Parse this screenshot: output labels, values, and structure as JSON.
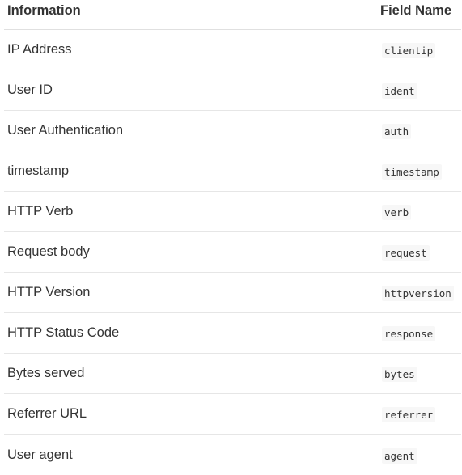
{
  "table": {
    "headers": {
      "information": "Information",
      "field_name": "Field Name"
    },
    "rows": [
      {
        "information": "IP Address",
        "field": "clientip"
      },
      {
        "information": "User ID",
        "field": "ident"
      },
      {
        "information": "User Authentication",
        "field": "auth"
      },
      {
        "information": "timestamp",
        "field": "timestamp"
      },
      {
        "information": "HTTP Verb",
        "field": "verb"
      },
      {
        "information": "Request body",
        "field": "request"
      },
      {
        "information": "HTTP Version",
        "field": "httpversion"
      },
      {
        "information": "HTTP Status Code",
        "field": "response"
      },
      {
        "information": "Bytes served",
        "field": "bytes"
      },
      {
        "information": "Referrer URL",
        "field": "referrer"
      },
      {
        "information": "User agent",
        "field": "agent"
      }
    ]
  }
}
